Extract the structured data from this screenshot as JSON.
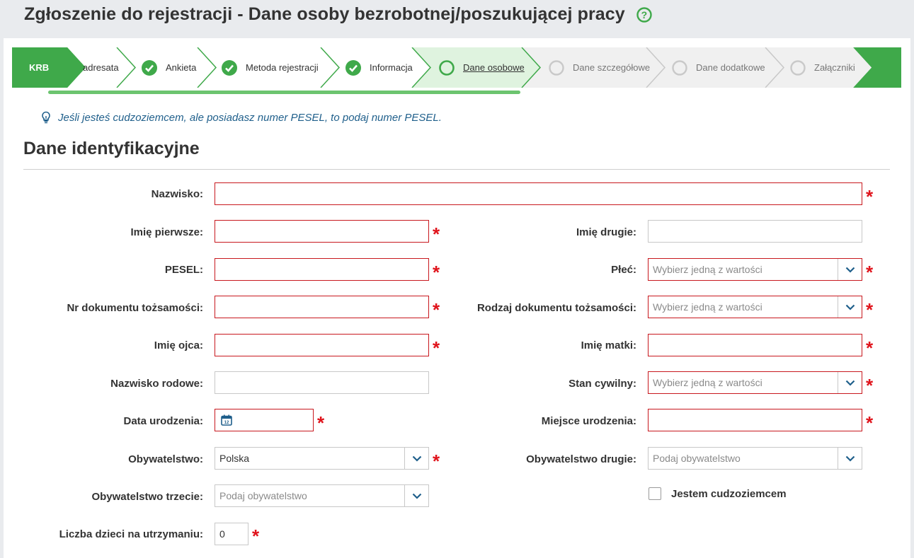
{
  "header": {
    "title": "Zgłoszenie do rejestracji - Dane osoby bezrobotnej/poszukującej pracy",
    "help_icon": "question-circle-icon"
  },
  "steps": {
    "prefix": "KRB",
    "items": [
      {
        "label": "adresata",
        "state": "done-partial"
      },
      {
        "label": "Ankieta",
        "state": "done"
      },
      {
        "label": "Metoda rejestracji",
        "state": "done"
      },
      {
        "label": "Informacja",
        "state": "done"
      },
      {
        "label": "Dane osobowe",
        "state": "current"
      },
      {
        "label": "Dane szczegółowe",
        "state": "todo"
      },
      {
        "label": "Dane dodatkowe",
        "state": "todo"
      },
      {
        "label": "Załączniki",
        "state": "todo"
      }
    ],
    "colors": {
      "done": "#3fa94a",
      "current": "#dff3df",
      "todo": "#eeeeee"
    }
  },
  "hint": {
    "text": "Jeśli jesteś cudzoziemcem, ale posiadasz numer PESEL, to podaj numer PESEL.",
    "icon": "lightbulb-icon"
  },
  "section": {
    "title": "Dane identyfikacyjne"
  },
  "form": {
    "nazwisko": {
      "label": "Nazwisko:",
      "value": ""
    },
    "imie_pierwsze": {
      "label": "Imię pierwsze:",
      "value": ""
    },
    "imie_drugie": {
      "label": "Imię drugie:",
      "value": ""
    },
    "pesel": {
      "label": "PESEL:",
      "value": ""
    },
    "plec": {
      "label": "Płeć:",
      "placeholder": "Wybierz jedną z wartości"
    },
    "nr_dokumentu": {
      "label": "Nr dokumentu tożsamości:",
      "value": ""
    },
    "rodzaj_dokumentu": {
      "label": "Rodzaj dokumentu tożsamości:",
      "placeholder": "Wybierz jedną z wartości"
    },
    "imie_ojca": {
      "label": "Imię ojca:",
      "value": ""
    },
    "imie_matki": {
      "label": "Imię matki:",
      "value": ""
    },
    "nazwisko_rodowe": {
      "label": "Nazwisko rodowe:",
      "value": ""
    },
    "stan_cywilny": {
      "label": "Stan cywilny:",
      "placeholder": "Wybierz jedną z wartości"
    },
    "data_urodzenia": {
      "label": "Data urodzenia:",
      "value": "",
      "icon": "calendar-icon"
    },
    "miejsce_urodzenia": {
      "label": "Miejsce urodzenia:",
      "value": ""
    },
    "obywatelstwo": {
      "label": "Obywatelstwo:",
      "value": "Polska"
    },
    "obywatelstwo_drugie": {
      "label": "Obywatelstwo drugie:",
      "placeholder": "Podaj obywatelstwo"
    },
    "obywatelstwo_trzecie": {
      "label": "Obywatelstwo trzecie:",
      "placeholder": "Podaj obywatelstwo"
    },
    "cudzoziemiec": {
      "label": "Jestem cudzoziemcem",
      "checked": false
    },
    "liczba_dzieci": {
      "label": "Liczba dzieci na utrzymaniu:",
      "value": "0"
    },
    "required_mark": "*"
  }
}
